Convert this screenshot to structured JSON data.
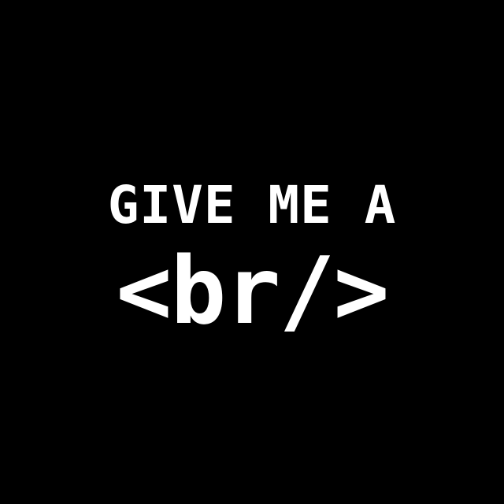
{
  "headline": {
    "line1": "GIVE ME A",
    "line2": "<br/>"
  },
  "colors": {
    "background": "#000000",
    "text": "#ffffff"
  }
}
